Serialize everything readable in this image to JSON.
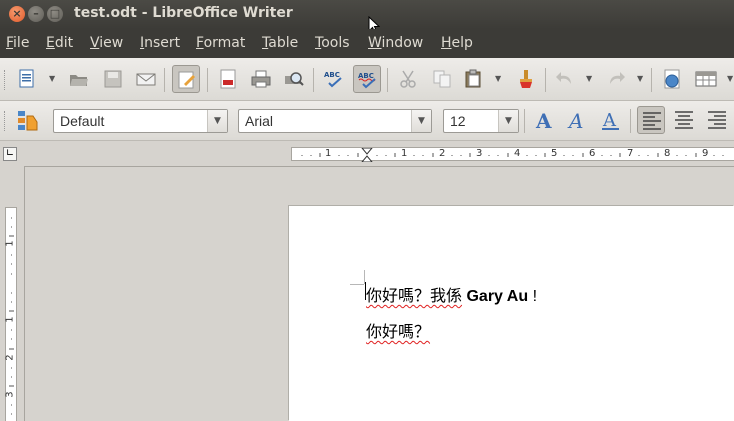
{
  "window": {
    "title": "test.odt - LibreOffice Writer"
  },
  "menu": [
    {
      "label": "File",
      "key": "F",
      "rest": "ile"
    },
    {
      "label": "Edit",
      "key": "E",
      "rest": "dit"
    },
    {
      "label": "View",
      "key": "V",
      "rest": "iew"
    },
    {
      "label": "Insert",
      "key": "I",
      "rest": "nsert"
    },
    {
      "label": "Format",
      "key": "F",
      "rest": "ormat"
    },
    {
      "label": "Table",
      "key": "T",
      "rest": "able"
    },
    {
      "label": "Tools",
      "key": "T",
      "rest": "ools"
    },
    {
      "label": "Window",
      "key": "W",
      "rest": "indow"
    },
    {
      "label": "Help",
      "key": "H",
      "rest": "elp"
    }
  ],
  "standard_toolbar": {
    "icons": [
      "new-document-icon",
      "open-icon",
      "save-icon",
      "email-icon",
      "edit-mode-icon",
      "export-pdf-icon",
      "print-icon",
      "print-preview-icon",
      "spellcheck-icon",
      "autospellcheck-icon",
      "cut-icon",
      "copy-icon",
      "paste-icon",
      "clone-formatting-icon",
      "undo-icon",
      "redo-icon",
      "navigator-icon",
      "table-icon"
    ]
  },
  "formatting_toolbar": {
    "paragraph_style": "Default",
    "font_name": "Arial",
    "font_size": "12",
    "icons": [
      "styles-icon",
      "bold-icon",
      "italic-icon",
      "underline-icon",
      "align-left-icon",
      "align-center-icon",
      "align-right-icon"
    ]
  },
  "ruler": {
    "h_labels": [
      "1",
      "1",
      "2",
      "3",
      "4",
      "5",
      "6",
      "7",
      "8",
      "9"
    ],
    "v_labels": [
      "1",
      "1",
      "2",
      "3"
    ]
  },
  "document": {
    "line1": {
      "cjk": "你好嗎？我係",
      "name": "Gary Au",
      "end": " !"
    },
    "line2": {
      "cjk": "你好嗎？"
    }
  },
  "colors": {
    "titlebar": "#3c3b37",
    "close_button": "#e05a2a",
    "spell_error": "#e02020"
  }
}
